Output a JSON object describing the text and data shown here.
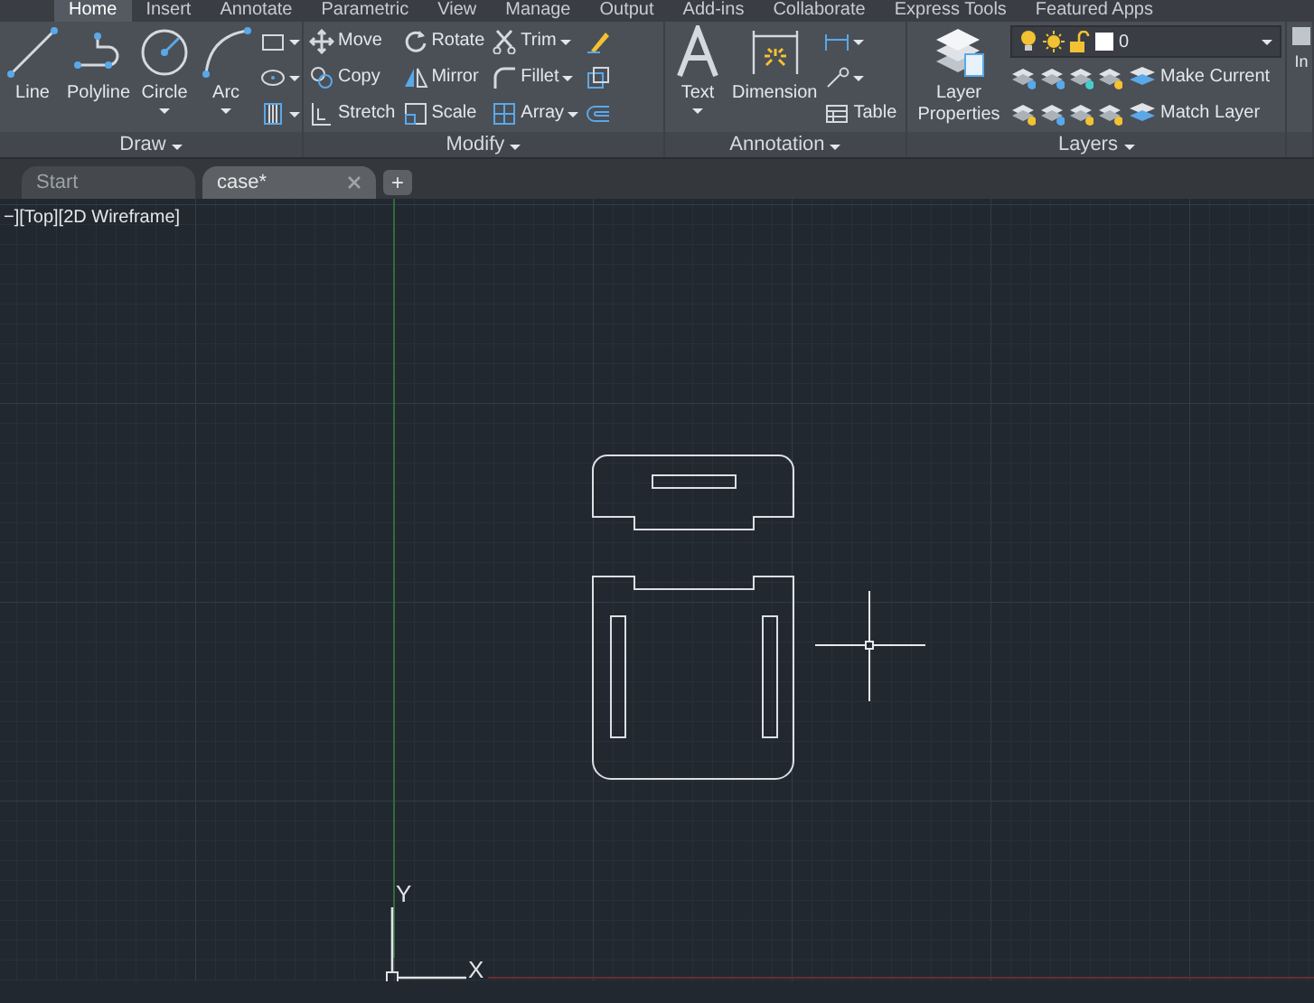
{
  "ribbon_tabs": [
    {
      "label": "Home",
      "selected": true
    },
    {
      "label": "Insert",
      "selected": false
    },
    {
      "label": "Annotate",
      "selected": false
    },
    {
      "label": "Parametric",
      "selected": false
    },
    {
      "label": "View",
      "selected": false
    },
    {
      "label": "Manage",
      "selected": false
    },
    {
      "label": "Output",
      "selected": false
    },
    {
      "label": "Add-ins",
      "selected": false
    },
    {
      "label": "Collaborate",
      "selected": false
    },
    {
      "label": "Express Tools",
      "selected": false
    },
    {
      "label": "Featured Apps",
      "selected": false
    }
  ],
  "panels": [
    {
      "title": "Draw",
      "columns": [
        {
          "kind": "large",
          "label": "Line",
          "dropdown": false
        },
        {
          "kind": "large",
          "label": "Polyline",
          "dropdown": false
        },
        {
          "kind": "large",
          "label": "Circle",
          "dropdown": true
        },
        {
          "kind": "large",
          "label": "Arc",
          "dropdown": true
        },
        {
          "kind": "small",
          "tools": [
            {
              "dropdown": true
            },
            {
              "dropdown": true
            },
            {
              "dropdown": true
            }
          ]
        }
      ]
    },
    {
      "title": "Modify",
      "columns": [
        {
          "kind": "small",
          "tools": [
            {
              "label": "Move",
              "dropdown": false
            },
            {
              "label": "Copy",
              "dropdown": false
            },
            {
              "label": "Stretch",
              "dropdown": false
            }
          ]
        },
        {
          "kind": "small",
          "tools": [
            {
              "label": "Rotate",
              "dropdown": false
            },
            {
              "label": "Mirror",
              "dropdown": false
            },
            {
              "label": "Scale",
              "dropdown": false
            }
          ]
        },
        {
          "kind": "small",
          "tools": [
            {
              "label": "Trim",
              "dropdown": true
            },
            {
              "label": "Fillet",
              "dropdown": true
            },
            {
              "label": "Array",
              "dropdown": true
            }
          ]
        },
        {
          "kind": "small",
          "tools": [
            {
              "dropdown": false
            },
            {
              "dropdown": false
            },
            {
              "dropdown": false
            }
          ]
        }
      ]
    },
    {
      "title": "Annotation",
      "columns": [
        {
          "kind": "large",
          "label": "Text",
          "dropdown": true
        },
        {
          "kind": "large",
          "label": "Dimension",
          "dropdown": false
        },
        {
          "kind": "small",
          "tools": [
            {
              "dropdown": true
            },
            {
              "dropdown": true
            },
            {
              "label": "Table",
              "dropdown": false
            }
          ]
        }
      ]
    },
    {
      "title": "Layers",
      "columns": [
        {
          "kind": "large",
          "label": "Layer Properties",
          "dropdown": false
        },
        {
          "kind": "layers",
          "current_layer": "0",
          "rows": [
            {
              "label": "Make Current"
            },
            {
              "label": "Match Layer"
            }
          ]
        }
      ]
    },
    {
      "columns": [
        {
          "kind": "large",
          "label": "In",
          "dropdown": false
        }
      ]
    }
  ],
  "file_tabs": [
    {
      "label": "Start",
      "selected": false,
      "closable": false
    },
    {
      "label": "case*",
      "selected": true,
      "closable": true
    }
  ],
  "new_tab": "+",
  "viewport_label": "−][Top][2D Wireframe]",
  "ucs": {
    "y_label": "Y",
    "x_label": "X"
  }
}
